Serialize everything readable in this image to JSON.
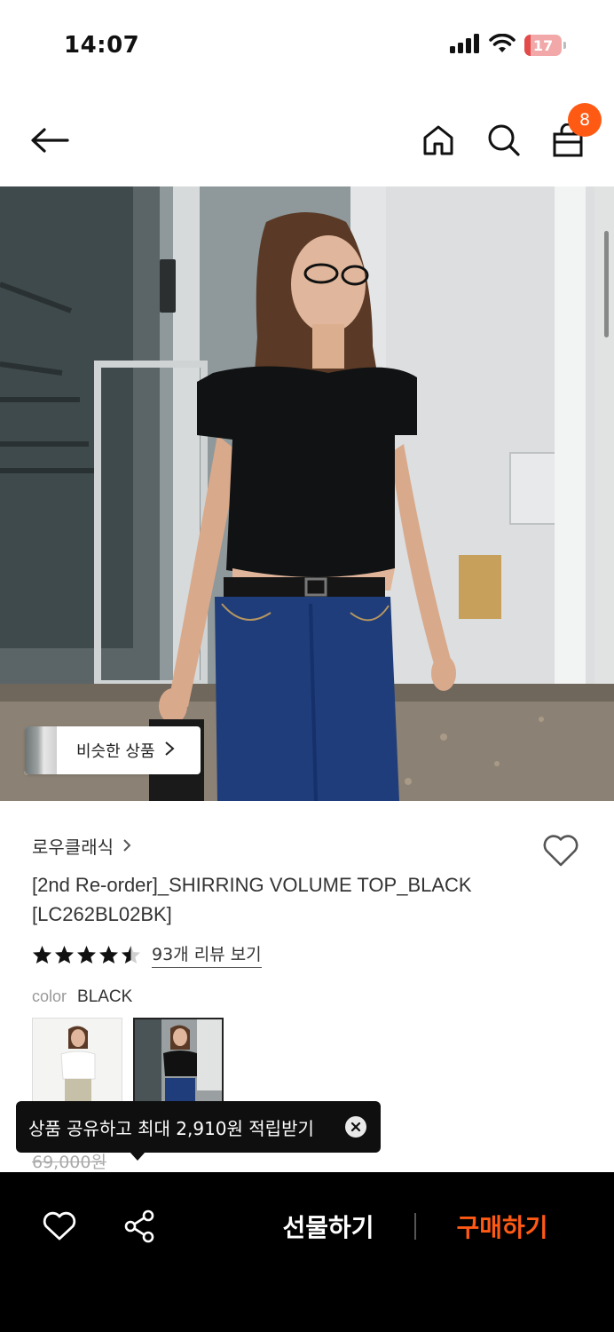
{
  "status_bar": {
    "time": "14:07",
    "battery": "17",
    "battery_level": 0.17,
    "icons": [
      "signal-icon",
      "wifi-icon",
      "battery-icon"
    ]
  },
  "nav": {
    "icons": [
      "back-arrow-icon",
      "home-icon",
      "search-icon",
      "shopping-bag-icon"
    ],
    "cart_count": "8"
  },
  "hero": {
    "similar_label": "비슷한 상품"
  },
  "product": {
    "brand": "로우클래식",
    "title": "[2nd Re-order]_SHIRRING VOLUME TOP_BLACK [LC262BL02BK]",
    "rating": 4.5,
    "review_link": "93개 리뷰 보기",
    "color_label": "color",
    "color_value": "BLACK",
    "swatches": [
      "white",
      "black"
    ],
    "price_old": "69,000원"
  },
  "tooltip": {
    "text": "상품 공유하고 최대 2,910원 적립받기"
  },
  "bottom_bar": {
    "gift_label": "선물하기",
    "buy_label": "구매하기"
  },
  "colors": {
    "accent": "#ff5a14",
    "bottom_bar_bg": "#000000",
    "tooltip_bg": "#0f0f0f"
  }
}
